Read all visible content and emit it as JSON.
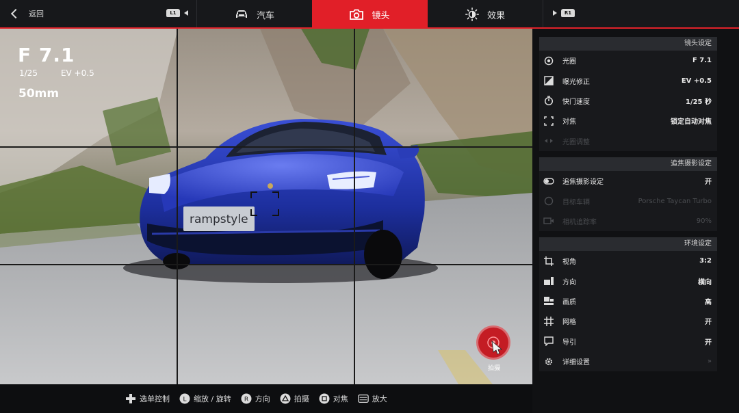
{
  "nav": {
    "back_label": "返回",
    "left_bumper": "L1",
    "right_bumper": "R1",
    "tabs": [
      {
        "label": "汽车",
        "icon": "car-icon"
      },
      {
        "label": "镜头",
        "icon": "camera-icon",
        "active": true
      },
      {
        "label": "效果",
        "icon": "brightness-icon"
      }
    ],
    "accent_color": "#e11f28"
  },
  "hud": {
    "aperture": "F 7.1",
    "shutter": "1/25",
    "ev": "EV +0.5",
    "focal_length": "50mm"
  },
  "viewport": {
    "plate_text": "rampstyle",
    "shutter_label": "拍摄",
    "shutter_icon": "shutter-button-icon"
  },
  "panel": {
    "lens": {
      "title": "镜头设定",
      "rows": [
        {
          "label": "光圈",
          "value": "F 7.1",
          "icon": "aperture-icon"
        },
        {
          "label": "曝光修正",
          "value": "EV +0.5",
          "icon": "exposure-icon"
        },
        {
          "label": "快门速度",
          "value": "1/25 秒",
          "icon": "timer-icon"
        },
        {
          "label": "对焦",
          "value": "锁定自动对焦",
          "icon": "focus-icon"
        },
        {
          "label": "光圈调整",
          "value": "",
          "icon": "aperture-adjust-icon",
          "disabled": true
        }
      ]
    },
    "tracking": {
      "title": "追焦摄影设定",
      "rows": [
        {
          "label": "追焦摄影设定",
          "value": "开",
          "icon": "toggle-icon"
        },
        {
          "label": "目标车辆",
          "value": "Porsche Taycan Turbo",
          "icon": "target-icon",
          "disabled": true
        },
        {
          "label": "相机追踪率",
          "value": "90%",
          "icon": "video-camera-icon",
          "disabled": true
        }
      ]
    },
    "environment": {
      "title": "环境设定",
      "rows": [
        {
          "label": "视角",
          "value": "3:2",
          "icon": "crop-icon"
        },
        {
          "label": "方向",
          "value": "横向",
          "icon": "orientation-icon"
        },
        {
          "label": "画质",
          "value": "高",
          "icon": "quality-icon"
        },
        {
          "label": "网格",
          "value": "开",
          "icon": "grid-icon"
        },
        {
          "label": "导引",
          "value": "开",
          "icon": "guide-icon"
        },
        {
          "label": "详细设置",
          "value": "»",
          "icon": "gear-icon"
        }
      ]
    }
  },
  "bottom": {
    "items": [
      {
        "label": "选单控制",
        "icon": "dpad-icon"
      },
      {
        "label": "缩放 / 旋转",
        "icon": "left-stick-icon"
      },
      {
        "label": "方向",
        "icon": "right-stick-icon"
      },
      {
        "label": "拍摄",
        "icon": "triangle-button-icon"
      },
      {
        "label": "对焦",
        "icon": "square-button-icon"
      },
      {
        "label": "放大",
        "icon": "touchpad-icon"
      }
    ]
  }
}
